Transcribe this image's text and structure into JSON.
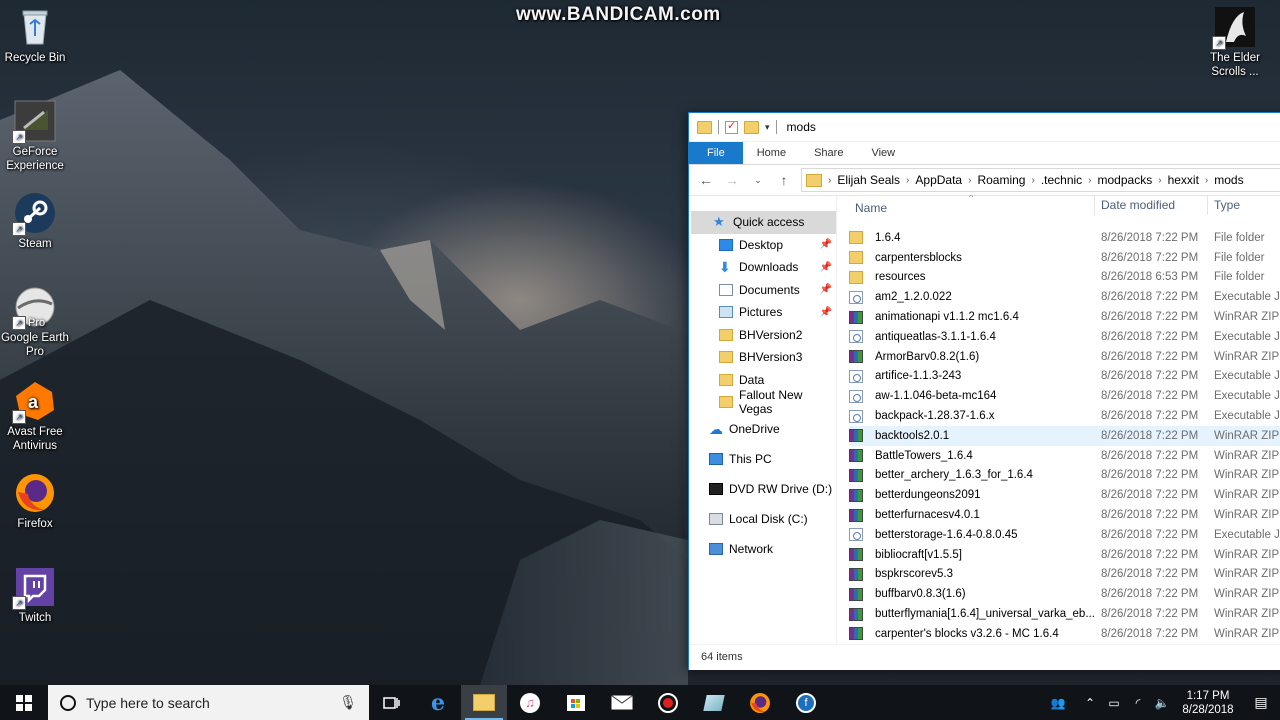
{
  "watermark": "www.BANDICAM.com",
  "desktop": {
    "icons": [
      {
        "label": "Recycle Bin"
      },
      {
        "label": "GeForce Experience"
      },
      {
        "label": "Steam"
      },
      {
        "label": "Google Earth Pro",
        "badge": "Pro"
      },
      {
        "label": "Avast Free Antivirus"
      },
      {
        "label": "Firefox"
      },
      {
        "label": "Twitch"
      },
      {
        "label": "The Elder Scrolls ..."
      }
    ]
  },
  "explorer": {
    "title": "mods",
    "ribbon": {
      "file": "File",
      "home": "Home",
      "share": "Share",
      "view": "View"
    },
    "breadcrumb": [
      "Elijah Seals",
      "AppData",
      "Roaming",
      ".technic",
      "modpacks",
      "hexxit",
      "mods"
    ],
    "nav": {
      "quick_access": "Quick access",
      "pinned": [
        "Desktop",
        "Downloads",
        "Documents",
        "Pictures"
      ],
      "folders": [
        "BHVersion2",
        "BHVersion3",
        "Data",
        "Fallout New Vegas"
      ],
      "onedrive": "OneDrive",
      "this_pc": "This PC",
      "dvd": "DVD RW Drive (D:) KC",
      "local_disk": "Local Disk (C:)",
      "network": "Network"
    },
    "columns": {
      "name": "Name",
      "date": "Date modified",
      "type": "Type"
    },
    "files": [
      {
        "name": "1.6.4",
        "date": "8/26/2018 7:22 PM",
        "type": "File folder",
        "icon": "folder-icon"
      },
      {
        "name": "carpentersblocks",
        "date": "8/26/2018 7:22 PM",
        "type": "File folder",
        "icon": "folder-icon"
      },
      {
        "name": "resources",
        "date": "8/26/2018 6:53 PM",
        "type": "File folder",
        "icon": "folder-icon"
      },
      {
        "name": "am2_1.2.0.022",
        "date": "8/26/2018 7:22 PM",
        "type": "Executable Jar",
        "icon": "jar-icon"
      },
      {
        "name": "animationapi v1.1.2 mc1.6.4",
        "date": "8/26/2018 7:22 PM",
        "type": "WinRAR ZIP a",
        "icon": "winrar-icon"
      },
      {
        "name": "antiqueatlas-3.1.1-1.6.4",
        "date": "8/26/2018 7:22 PM",
        "type": "Executable Jar",
        "icon": "jar-icon"
      },
      {
        "name": "ArmorBarv0.8.2(1.6)",
        "date": "8/26/2018 7:22 PM",
        "type": "WinRAR ZIP a",
        "icon": "winrar-icon"
      },
      {
        "name": "artifice-1.1.3-243",
        "date": "8/26/2018 7:22 PM",
        "type": "Executable Jar",
        "icon": "jar-icon"
      },
      {
        "name": "aw-1.1.046-beta-mc164",
        "date": "8/26/2018 7:22 PM",
        "type": "Executable Jar",
        "icon": "jar-icon"
      },
      {
        "name": "backpack-1.28.37-1.6.x",
        "date": "8/26/2018 7:22 PM",
        "type": "Executable Jar",
        "icon": "jar-icon"
      },
      {
        "name": "backtools2.0.1",
        "date": "8/26/2018 7:22 PM",
        "type": "WinRAR ZIP a",
        "icon": "winrar-icon"
      },
      {
        "name": "BattleTowers_1.6.4",
        "date": "8/26/2018 7:22 PM",
        "type": "WinRAR ZIP a",
        "icon": "winrar-icon"
      },
      {
        "name": "better_archery_1.6.3_for_1.6.4",
        "date": "8/26/2018 7:22 PM",
        "type": "WinRAR ZIP a",
        "icon": "winrar-icon"
      },
      {
        "name": "betterdungeons2091",
        "date": "8/26/2018 7:22 PM",
        "type": "WinRAR ZIP a",
        "icon": "winrar-icon"
      },
      {
        "name": "betterfurnacesv4.0.1",
        "date": "8/26/2018 7:22 PM",
        "type": "WinRAR ZIP a",
        "icon": "winrar-icon"
      },
      {
        "name": "betterstorage-1.6.4-0.8.0.45",
        "date": "8/26/2018 7:22 PM",
        "type": "Executable Jar",
        "icon": "jar-icon"
      },
      {
        "name": "bibliocraft[v1.5.5]",
        "date": "8/26/2018 7:22 PM",
        "type": "WinRAR ZIP a",
        "icon": "winrar-icon"
      },
      {
        "name": "bspkrscorev5.3",
        "date": "8/26/2018 7:22 PM",
        "type": "WinRAR ZIP a",
        "icon": "winrar-icon"
      },
      {
        "name": "buffbarv0.8.3(1.6)",
        "date": "8/26/2018 7:22 PM",
        "type": "WinRAR ZIP a",
        "icon": "winrar-icon"
      },
      {
        "name": "butterflymania[1.6.4]_universal_varka_eb...",
        "date": "8/26/2018 7:22 PM",
        "type": "WinRAR ZIP a",
        "icon": "winrar-icon"
      },
      {
        "name": "carpenter's blocks v3.2.6 - MC 1.6.4",
        "date": "8/26/2018 7:22 PM",
        "type": "WinRAR ZIP a",
        "icon": "winrar-icon"
      }
    ],
    "status": "64 items"
  },
  "taskbar": {
    "search_placeholder": "Type here to search",
    "clock_time": "1:17 PM",
    "clock_date": "8/28/2018"
  }
}
